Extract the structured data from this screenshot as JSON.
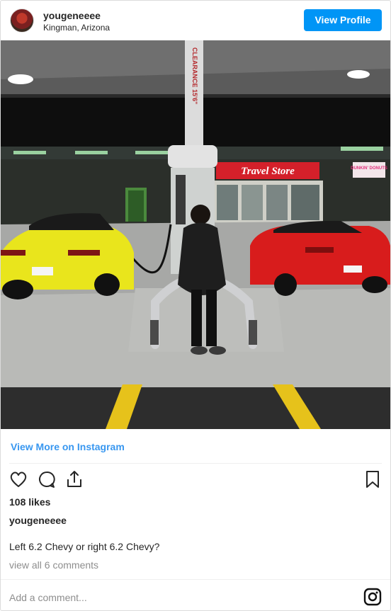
{
  "header": {
    "username": "yougeneeee",
    "location": "Kingman, Arizona",
    "view_profile_label": "View Profile"
  },
  "photo": {
    "canopy_sign": "CLEARANCE 15'6\"",
    "store_sign": "Travel Store",
    "donut_sign": "DUNKIN' DONUTS",
    "colors": {
      "left_car": "#e9e51c",
      "right_car": "#d81c1c",
      "store_sign_bg": "#d4202a"
    }
  },
  "links": {
    "view_more": "View More on Instagram"
  },
  "actions": {
    "like_icon": "heart-icon",
    "comment_icon": "comment-icon",
    "share_icon": "share-icon",
    "save_icon": "bookmark-icon"
  },
  "post": {
    "likes": "108 likes",
    "username": "yougeneeee",
    "caption": "Left 6.2 Chevy or right 6.2 Chevy?",
    "comments_link": "view all 6 comments",
    "comment_placeholder": "Add a comment..."
  },
  "brand": {
    "accent": "#0095f6",
    "link": "#3897f0",
    "logo_icon": "instagram-icon"
  }
}
